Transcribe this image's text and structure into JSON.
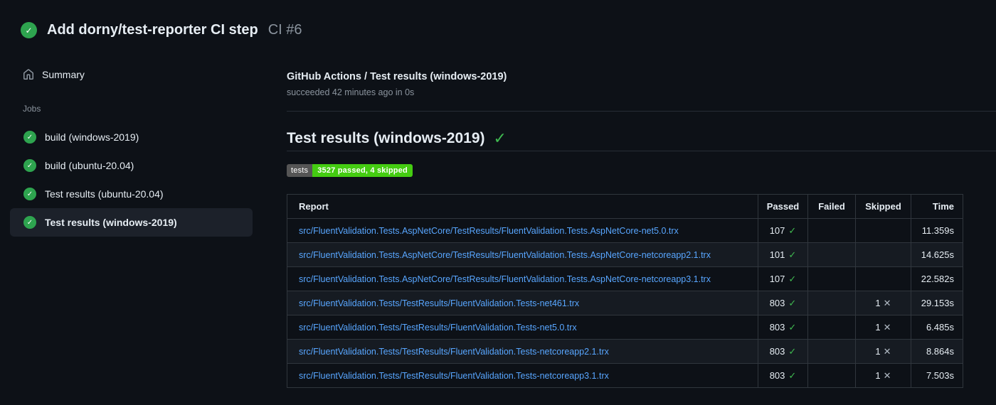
{
  "header": {
    "title": "Add dorny/test-reporter CI step",
    "run_number": "CI #6"
  },
  "sidebar": {
    "summary_label": "Summary",
    "jobs_label": "Jobs",
    "jobs": [
      {
        "label": "build (windows-2019)",
        "selected": false
      },
      {
        "label": "build (ubuntu-20.04)",
        "selected": false
      },
      {
        "label": "Test results (ubuntu-20.04)",
        "selected": false
      },
      {
        "label": "Test results (windows-2019)",
        "selected": true
      }
    ]
  },
  "main": {
    "check_title": "GitHub Actions / Test results (windows-2019)",
    "check_status": "succeeded 42 minutes ago in 0s",
    "section_title": "Test results (windows-2019)",
    "badge": {
      "label": "tests",
      "value": "3527 passed, 4 skipped"
    },
    "table": {
      "headers": [
        "Report",
        "Passed",
        "Failed",
        "Skipped",
        "Time"
      ],
      "rows": [
        {
          "report": "src/FluentValidation.Tests.AspNetCore/TestResults/FluentValidation.Tests.AspNetCore-net5.0.trx",
          "passed": "107",
          "failed": "",
          "skipped": "",
          "time": "11.359s"
        },
        {
          "report": "src/FluentValidation.Tests.AspNetCore/TestResults/FluentValidation.Tests.AspNetCore-netcoreapp2.1.trx",
          "passed": "101",
          "failed": "",
          "skipped": "",
          "time": "14.625s"
        },
        {
          "report": "src/FluentValidation.Tests.AspNetCore/TestResults/FluentValidation.Tests.AspNetCore-netcoreapp3.1.trx",
          "passed": "107",
          "failed": "",
          "skipped": "",
          "time": "22.582s"
        },
        {
          "report": "src/FluentValidation.Tests/TestResults/FluentValidation.Tests-net461.trx",
          "passed": "803",
          "failed": "",
          "skipped": "1",
          "time": "29.153s"
        },
        {
          "report": "src/FluentValidation.Tests/TestResults/FluentValidation.Tests-net5.0.trx",
          "passed": "803",
          "failed": "",
          "skipped": "1",
          "time": "6.485s"
        },
        {
          "report": "src/FluentValidation.Tests/TestResults/FluentValidation.Tests-netcoreapp2.1.trx",
          "passed": "803",
          "failed": "",
          "skipped": "1",
          "time": "8.864s"
        },
        {
          "report": "src/FluentValidation.Tests/TestResults/FluentValidation.Tests-netcoreapp3.1.trx",
          "passed": "803",
          "failed": "",
          "skipped": "1",
          "time": "7.503s"
        }
      ]
    }
  },
  "icons": {
    "run_status": "check-circle",
    "summary": "home",
    "job_status": "check-circle",
    "check_glyph": "✓",
    "skipped_glyph": "✕"
  },
  "colors": {
    "background": "#0d1117",
    "surface_selected": "#1c212a",
    "row_alt": "#161b22",
    "border": "#30363d",
    "divider": "#272d36",
    "text_primary": "#e6edf3",
    "text_secondary": "#8b949e",
    "link": "#58a6ff",
    "success_green": "#2ea44f",
    "check_green": "#3fb950",
    "skipped_mark": "#b1bac4",
    "badge_label_bg": "#555555",
    "badge_value_bg": "#44cc11"
  }
}
